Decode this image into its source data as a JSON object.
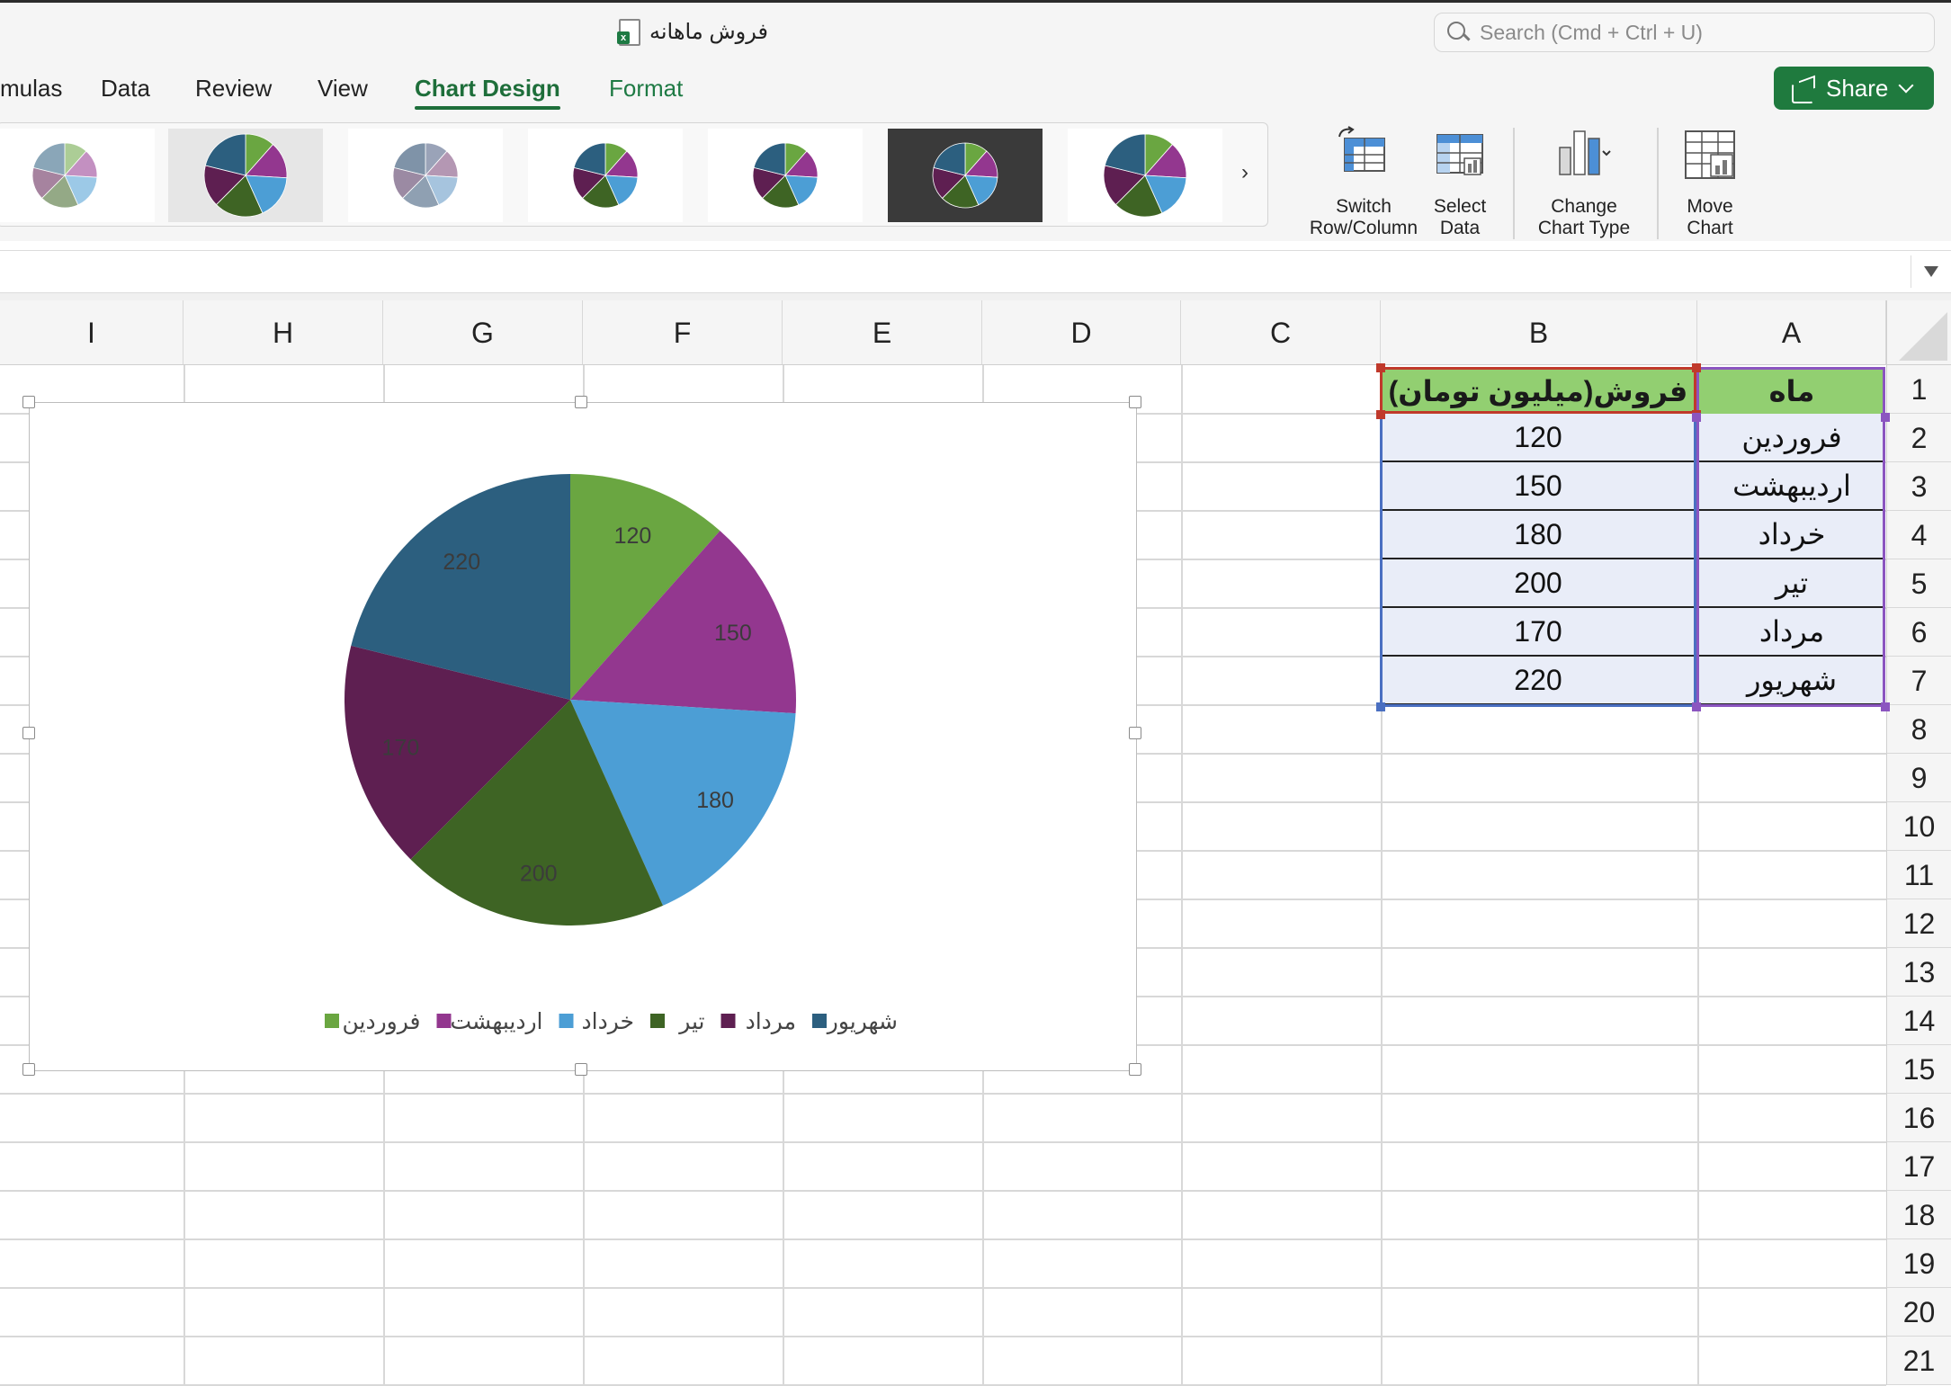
{
  "window": {
    "title": "فروش ماهانه",
    "search_placeholder": "Search (Cmd + Ctrl + U)"
  },
  "menu": {
    "tabs": [
      {
        "label": "mulas"
      },
      {
        "label": "Data"
      },
      {
        "label": "Review"
      },
      {
        "label": "View"
      },
      {
        "label": "Chart Design",
        "active": true
      },
      {
        "label": "Format"
      }
    ],
    "share_label": "Share"
  },
  "ribbon": {
    "style_gallery_count": 7,
    "buttons": [
      {
        "line1": "Switch",
        "line2": "Row/Column",
        "icon": "switch-row-column-icon"
      },
      {
        "line1": "Select",
        "line2": "Data",
        "icon": "select-data-icon"
      },
      {
        "line1": "Change",
        "line2": "Chart Type",
        "icon": "change-chart-type-icon"
      },
      {
        "line1": "Move",
        "line2": "Chart",
        "icon": "move-chart-icon"
      }
    ]
  },
  "sheet": {
    "column_headers": [
      "I",
      "H",
      "G",
      "F",
      "E",
      "D",
      "C",
      "B",
      "A"
    ],
    "row_numbers": [
      "1",
      "2",
      "3",
      "4",
      "5",
      "6",
      "7",
      "8",
      "9",
      "10",
      "11",
      "12",
      "13",
      "14",
      "15",
      "16",
      "17",
      "18",
      "19",
      "20",
      "21"
    ],
    "header_row": {
      "A": "ماه",
      "B": "فروش(میلیون تومان)"
    },
    "rows": [
      {
        "A": "فروردین",
        "B": "120"
      },
      {
        "A": "اردیبهشت",
        "B": "150"
      },
      {
        "A": "خرداد",
        "B": "180"
      },
      {
        "A": "تیر",
        "B": "200"
      },
      {
        "A": "مرداد",
        "B": "170"
      },
      {
        "A": "شهریور",
        "B": "220"
      }
    ]
  },
  "chart_data": {
    "type": "pie",
    "categories": [
      "فروردین",
      "اردیبهشت",
      "خرداد",
      "تیر",
      "مرداد",
      "شهریور"
    ],
    "values": [
      120,
      150,
      180,
      200,
      170,
      220
    ],
    "colors": [
      "#6aa641",
      "#93378f",
      "#4c9ed5",
      "#3e6424",
      "#5e1f51",
      "#2c5f7f"
    ],
    "data_labels": [
      "120",
      "150",
      "180",
      "200",
      "170",
      "220"
    ],
    "title": "",
    "legend_position": "bottom",
    "legend_entries": [
      "فروردین",
      "اردیبهشت",
      "خرداد",
      "تیر",
      "مرداد",
      "شهریور"
    ]
  }
}
